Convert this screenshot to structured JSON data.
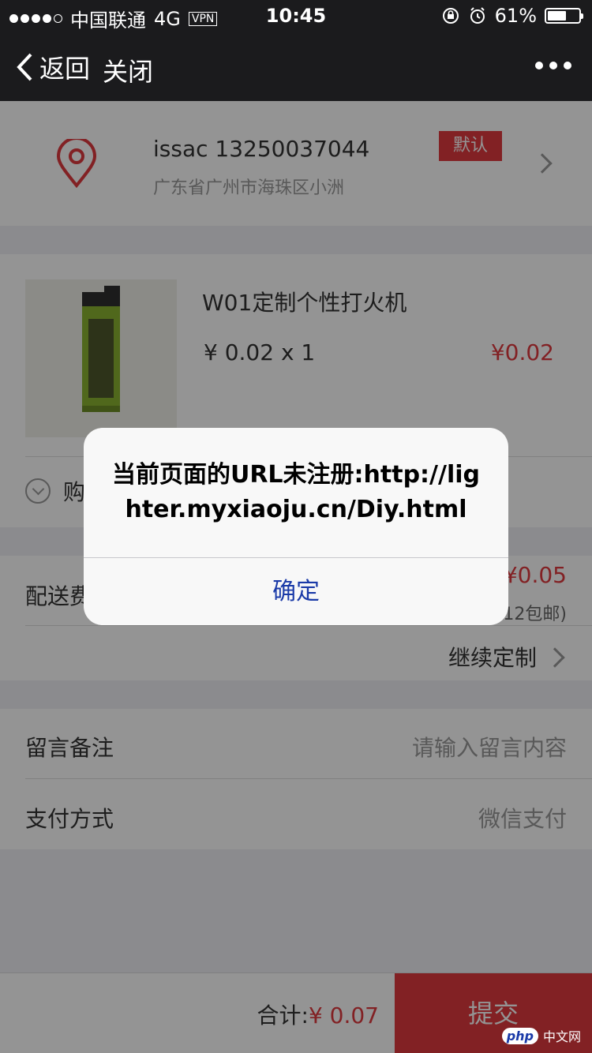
{
  "status_bar": {
    "carrier": "中国联通",
    "network": "4G",
    "vpn": "VPN",
    "time": "10:45",
    "battery": "61%"
  },
  "nav": {
    "back_label": "返回",
    "close_label": "关闭"
  },
  "address": {
    "name_phone": "issac 13250037044",
    "detail": "广东省广州市海珠区小洲",
    "default_badge": "默认"
  },
  "product": {
    "title": "W01定制个性打火机",
    "price_qty": "¥ 0.02 x 1",
    "total": "¥0.02",
    "expand_label": "购"
  },
  "shipping": {
    "label": "配送费",
    "fee": "¥0.05",
    "note": "12包邮)",
    "continue_label": "继续定制"
  },
  "remarks": {
    "note_label": "留言备注",
    "note_placeholder": "请输入留言内容",
    "payment_label": "支付方式",
    "payment_value": "微信支付"
  },
  "footer": {
    "sum_label": "合计:",
    "sum_amount": "¥ 0.07",
    "submit_label": "提交"
  },
  "alert": {
    "message": "当前页面的URL未注册:http://lighter.myxiaoju.cn/Diy.html",
    "ok_label": "确定"
  },
  "watermark": {
    "logo": "php",
    "site": "中文网"
  },
  "colors": {
    "accent": "#e0393e",
    "link": "#1a3aa8",
    "nav_bg": "#1b1b1d"
  }
}
